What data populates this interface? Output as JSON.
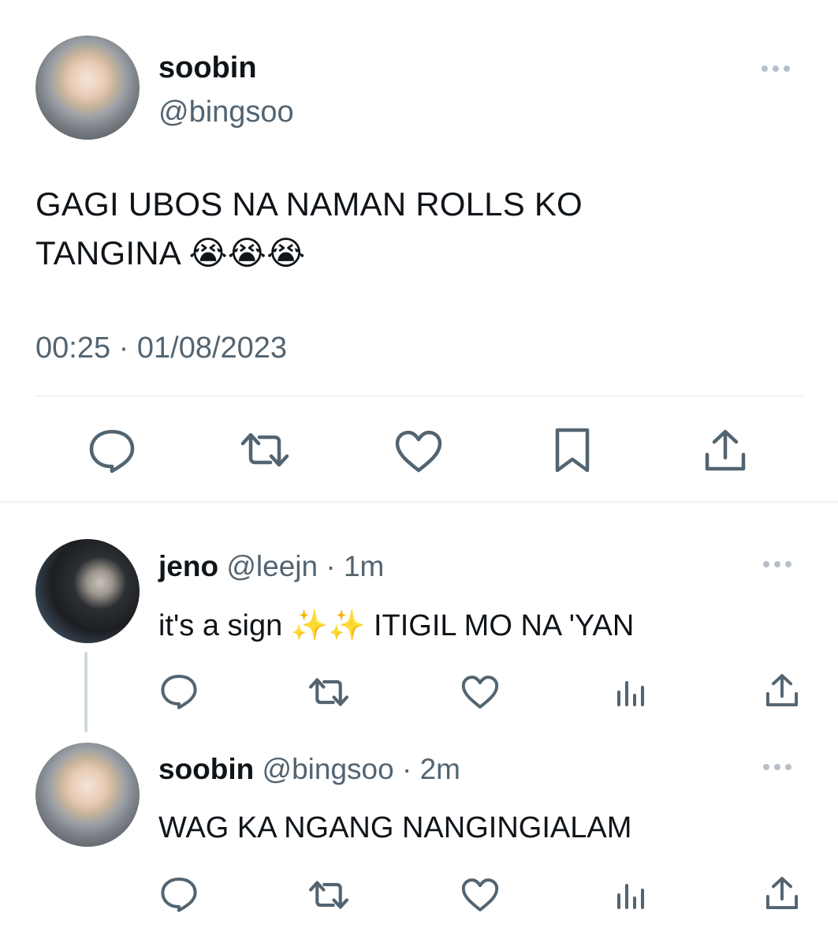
{
  "main_tweet": {
    "name": "soobin",
    "handle": "@bingsoo",
    "text_line1": "GAGI UBOS NA NAMAN ROLLS KO",
    "text_line2": "TANGINA 😭😭😭",
    "timestamp": "00:25 · 01/08/2023",
    "actions": [
      "reply-icon",
      "retweet-icon",
      "like-icon",
      "bookmark-icon",
      "share-icon"
    ]
  },
  "replies": [
    {
      "name": "jeno",
      "handle": "@leejn",
      "time": " · 1m",
      "text": "it's a sign ✨✨ ITIGIL MO NA 'YAN",
      "actions": [
        "reply-icon",
        "retweet-icon",
        "like-icon",
        "views-icon",
        "share-icon"
      ]
    },
    {
      "name": "soobin",
      "handle": "@bingsoo",
      "time": " · 2m",
      "text": "WAG KA NGANG NANGINGIALAM",
      "actions": [
        "reply-icon",
        "retweet-icon",
        "like-icon",
        "views-icon",
        "share-icon"
      ]
    }
  ],
  "colors": {
    "text": "#0f1419",
    "secondary": "#536471",
    "icon": "#536471",
    "divider": "#eff3f4",
    "thread_line": "#cfd9de"
  }
}
